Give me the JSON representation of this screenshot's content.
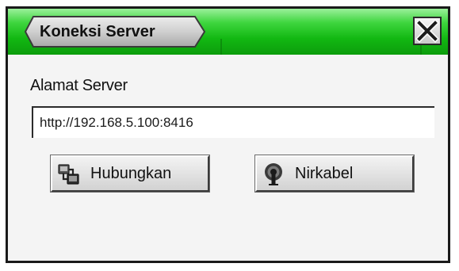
{
  "dialog": {
    "title": "Koneksi Server",
    "close_icon": "close-x-icon"
  },
  "form": {
    "label": "Alamat Server",
    "address_value": "http://192.168.5.100:8416"
  },
  "buttons": {
    "connect": {
      "label": "Hubungkan",
      "icon": "network-connect-icon"
    },
    "wireless": {
      "label": "Nirkabel",
      "icon": "wireless-antenna-icon"
    }
  },
  "colors": {
    "titlebar_green": "#12b812",
    "title_tab_gray": "#c8c8c8",
    "frame": "#1a1a1a"
  }
}
